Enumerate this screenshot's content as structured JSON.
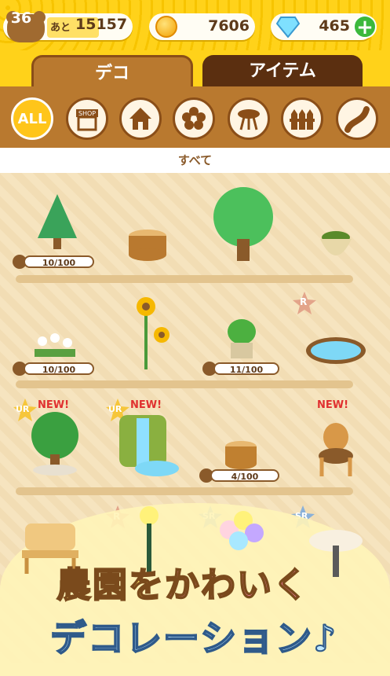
{
  "header": {
    "level": "36",
    "remain_prefix": "あと",
    "remain_value": "15157",
    "coins": "7606",
    "gems": "465"
  },
  "tabs": [
    {
      "label": "デコ",
      "active": true
    },
    {
      "label": "アイテム",
      "active": false
    }
  ],
  "categories": {
    "all_label": "ALL",
    "shop_label": "SHOP",
    "icons": [
      "all-icon",
      "shop-icon",
      "house-icon",
      "flower-icon",
      "table-icon",
      "fence-icon",
      "path-icon"
    ]
  },
  "filter_label": "すべて",
  "items": {
    "tree_pine_count": "10/100",
    "flowers_count": "10/100",
    "plant_pot_count": "11/100",
    "stump_count": "4/100",
    "rarity_r": "R",
    "rarity_ur": "UR",
    "rarity_sr": "SR",
    "new_label": "NEW!"
  },
  "banner": {
    "line1_a": "農園を",
    "line1_b": "かわいく",
    "line2": "デコレーション♪"
  },
  "colors": {
    "yellow": "#ffd21a",
    "brown": "#b9792f",
    "dark_brown": "#5b2f10",
    "green": "#3cb83c",
    "new_red": "#e03030"
  }
}
